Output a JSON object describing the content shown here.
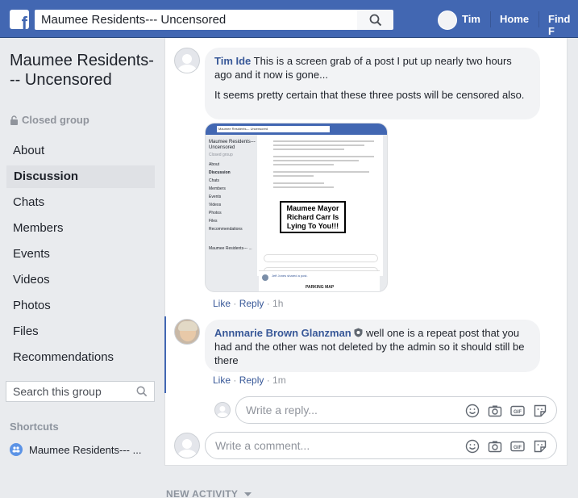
{
  "topbar": {
    "search_value": "Maumee Residents--- Uncensored",
    "user_name": "Tim",
    "home_label": "Home",
    "find_label": "Find F",
    "brand_color": "#4267b2"
  },
  "group": {
    "name": "Maumee Residents--- Uncensored",
    "privacy": "Closed group"
  },
  "sidebar": {
    "items": [
      {
        "label": "About"
      },
      {
        "label": "Discussion"
      },
      {
        "label": "Chats"
      },
      {
        "label": "Members"
      },
      {
        "label": "Events"
      },
      {
        "label": "Videos"
      },
      {
        "label": "Photos"
      },
      {
        "label": "Files"
      },
      {
        "label": "Recommendations"
      }
    ],
    "search_placeholder": "Search this group",
    "shortcuts_title": "Shortcuts",
    "shortcut_label": "Maumee Residents--- ..."
  },
  "comments": [
    {
      "author": "Tim Ide",
      "text1": "This is a screen grab of a post I put up nearly two hours ago and it now is gone...",
      "text2": "It seems pretty certain that these three posts will be censored also.",
      "like": "Like",
      "reply": "Reply",
      "time": "1h"
    },
    {
      "author": "Annmarie Brown Glanzman",
      "text": "well one is a repeat post that you had and the other was not deleted by the admin so it should still be there",
      "like": "Like",
      "reply": "Reply",
      "time": "1m"
    }
  ],
  "screenshot": {
    "search": "Maumee Residents--- Uncensored",
    "group_name": "Maumee Residents--- Uncensored",
    "privacy": "Closed group",
    "nav": [
      "About",
      "Discussion",
      "Chats",
      "Members",
      "Events",
      "Videos",
      "Photos",
      "Files",
      "Recommendations"
    ],
    "sign_text": "Maumee Mayor Richard Carr Is Lying To You!!!",
    "caption": "PARKING MAP",
    "shortcut": "Maumee Residents--- ...",
    "poster": "Jeff Jones shared a post."
  },
  "inputs": {
    "reply_placeholder": "Write a reply...",
    "comment_placeholder": "Write a comment..."
  },
  "footer": {
    "new_activity": "NEW ACTIVITY"
  }
}
